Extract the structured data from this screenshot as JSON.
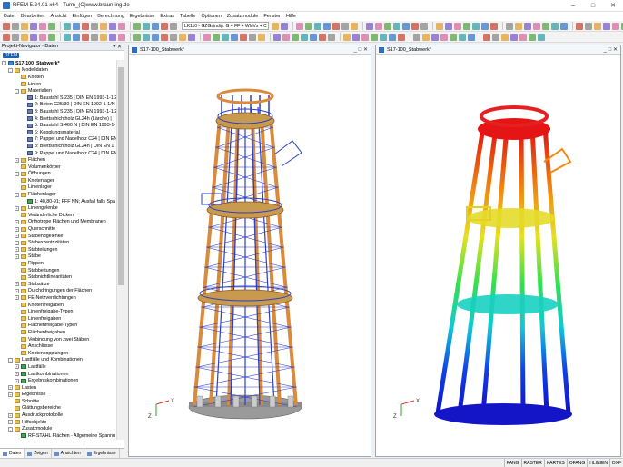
{
  "window": {
    "title": "RFEM 5.24.01 x64 - Turm_(C)www.braun-ing.de",
    "minimize": "–",
    "maximize": "□",
    "close": "✕"
  },
  "menu": [
    "Datei",
    "Bearbeiten",
    "Ansicht",
    "Einfügen",
    "Berechnung",
    "Ergebnisse",
    "Extras",
    "Tabelle",
    "Optionen",
    "Zusatzmodule",
    "Fenster",
    "Hilfe"
  ],
  "toolbar": {
    "load_combo": "LK110 - GZGstndig: G + FF + WlnVx + C"
  },
  "navigator": {
    "title": "Projekt-Navigator - Daten",
    "controls": "▾ ✕",
    "root": "RFEM",
    "tree": [
      {
        "level": 0,
        "exp": "−",
        "icon": "model",
        "label": "S17-100_Stabwerk*",
        "bold": true
      },
      {
        "level": 1,
        "exp": "−",
        "icon": "folder",
        "label": "Modelldaten"
      },
      {
        "level": 2,
        "exp": "",
        "icon": "folder",
        "label": "Knoten"
      },
      {
        "level": 2,
        "exp": "",
        "icon": "folder",
        "label": "Linien"
      },
      {
        "level": 2,
        "exp": "−",
        "icon": "folder",
        "label": "Materialien"
      },
      {
        "level": 3,
        "exp": "",
        "icon": "mat",
        "label": "1: Baustahl S 235 | DIN EN 1993-1-1:2"
      },
      {
        "level": 3,
        "exp": "",
        "icon": "mat",
        "label": "2: Beton C25/30 | DIN EN 1992-1-1/N"
      },
      {
        "level": 3,
        "exp": "",
        "icon": "mat",
        "label": "3: Baustahl S 235 | DIN EN 1993-1-1:2"
      },
      {
        "level": 3,
        "exp": "",
        "icon": "mat",
        "label": "4: Brettschichtholz GL24h (Lärche) |"
      },
      {
        "level": 3,
        "exp": "",
        "icon": "mat",
        "label": "5: Baustahl S 460 N | DIN EN 1993-1-"
      },
      {
        "level": 3,
        "exp": "",
        "icon": "mat",
        "label": "6: Kopplungsmaterial"
      },
      {
        "level": 3,
        "exp": "",
        "icon": "mat",
        "label": "7: Pappel und Nadelholz C24 | DIN EN"
      },
      {
        "level": 3,
        "exp": "",
        "icon": "mat",
        "label": "8: Brettschichtholz GL24h | DIN EN 1"
      },
      {
        "level": 3,
        "exp": "",
        "icon": "mat",
        "label": "9: Pappel und Nadelholz C24 | DIN EN"
      },
      {
        "level": 2,
        "exp": "+",
        "icon": "folder",
        "label": "Flächen"
      },
      {
        "level": 2,
        "exp": "",
        "icon": "folder",
        "label": "Volumenkörper"
      },
      {
        "level": 2,
        "exp": "+",
        "icon": "folder",
        "label": "Öffnungen"
      },
      {
        "level": 2,
        "exp": "",
        "icon": "folder",
        "label": "Knotenlager"
      },
      {
        "level": 2,
        "exp": "",
        "icon": "folder",
        "label": "Linienlager"
      },
      {
        "level": 2,
        "exp": "−",
        "icon": "folder",
        "label": "Flächenlager"
      },
      {
        "level": 3,
        "exp": "",
        "icon": "load",
        "label": "1: 40,80-91; FFF NN; Ausfall falls Spa"
      },
      {
        "level": 2,
        "exp": "+",
        "icon": "folder",
        "label": "Liniengelenke"
      },
      {
        "level": 2,
        "exp": "",
        "icon": "folder",
        "label": "Veränderliche Dicken"
      },
      {
        "level": 2,
        "exp": "+",
        "icon": "folder",
        "label": "Orthotrope Flächen und Membranen"
      },
      {
        "level": 2,
        "exp": "+",
        "icon": "folder",
        "label": "Querschnitte"
      },
      {
        "level": 2,
        "exp": "+",
        "icon": "folder",
        "label": "Stabendgelenke"
      },
      {
        "level": 2,
        "exp": "+",
        "icon": "folder",
        "label": "Stabexzentrizitäten"
      },
      {
        "level": 2,
        "exp": "+",
        "icon": "folder",
        "label": "Stabteilungen"
      },
      {
        "level": 2,
        "exp": "+",
        "icon": "folder",
        "label": "Stäbe"
      },
      {
        "level": 2,
        "exp": "",
        "icon": "folder",
        "label": "Rippen"
      },
      {
        "level": 2,
        "exp": "",
        "icon": "folder",
        "label": "Stabbettungen"
      },
      {
        "level": 2,
        "exp": "",
        "icon": "folder",
        "label": "Stabnichtlinearitäten"
      },
      {
        "level": 2,
        "exp": "+",
        "icon": "folder",
        "label": "Stabsätze"
      },
      {
        "level": 2,
        "exp": "+",
        "icon": "folder",
        "label": "Durchdringungen der Flächen"
      },
      {
        "level": 2,
        "exp": "+",
        "icon": "folder",
        "label": "FE-Netzverdichtungen"
      },
      {
        "level": 2,
        "exp": "",
        "icon": "folder",
        "label": "Knotenfreigaben"
      },
      {
        "level": 2,
        "exp": "",
        "icon": "folder",
        "label": "Linienfreigabe-Typen"
      },
      {
        "level": 2,
        "exp": "",
        "icon": "folder",
        "label": "Linienfreigaben"
      },
      {
        "level": 2,
        "exp": "",
        "icon": "folder",
        "label": "Flächenfreigabe-Typen"
      },
      {
        "level": 2,
        "exp": "",
        "icon": "folder",
        "label": "Flächenfreigaben"
      },
      {
        "level": 2,
        "exp": "",
        "icon": "folder",
        "label": "Verbindung von zwei Stäben"
      },
      {
        "level": 2,
        "exp": "",
        "icon": "folder",
        "label": "Anschlüsse"
      },
      {
        "level": 2,
        "exp": "",
        "icon": "folder",
        "label": "Knotenkopplungen"
      },
      {
        "level": 1,
        "exp": "−",
        "icon": "folder",
        "label": "Lastfälle und Kombinationen"
      },
      {
        "level": 2,
        "exp": "+",
        "icon": "load",
        "label": "Lastfälle"
      },
      {
        "level": 2,
        "exp": "+",
        "icon": "load",
        "label": "Lastkombinationen"
      },
      {
        "level": 2,
        "exp": "+",
        "icon": "load",
        "label": "Ergebniskombinationen"
      },
      {
        "level": 1,
        "exp": "+",
        "icon": "folder",
        "label": "Lasten"
      },
      {
        "level": 1,
        "exp": "+",
        "icon": "folder",
        "label": "Ergebnisse"
      },
      {
        "level": 1,
        "exp": "",
        "icon": "folder",
        "label": "Schnitte"
      },
      {
        "level": 1,
        "exp": "",
        "icon": "folder",
        "label": "Glättungsbereiche"
      },
      {
        "level": 1,
        "exp": "+",
        "icon": "folder",
        "label": "Ausdruckprotokolle"
      },
      {
        "level": 1,
        "exp": "+",
        "icon": "folder",
        "label": "Hilfsobjekte"
      },
      {
        "level": 1,
        "exp": "−",
        "icon": "folder",
        "label": "Zusatzmodule"
      },
      {
        "level": 2,
        "exp": "",
        "icon": "load",
        "label": "RF-STAHL Flächen - Allgemeine Spannu"
      }
    ],
    "tabs": [
      "Daten",
      "Zeigen",
      "Ansichten",
      "Ergebnisse"
    ]
  },
  "views": [
    {
      "title": "S17-100_Stabwerk*"
    },
    {
      "title": "S17-100_Stabwerk*"
    }
  ],
  "view_controls": "_ □ ✕",
  "axes": {
    "x": "X",
    "z": "Z"
  },
  "statusbar": [
    "FANG",
    "RASTER",
    "KARTES",
    "OFANG",
    "HLINIEN",
    "DXF"
  ],
  "colors": {
    "timber": "#d98a3a",
    "steel": "#2b3fc8",
    "deck": "#c89a4e",
    "base": "#9a9a9a"
  }
}
